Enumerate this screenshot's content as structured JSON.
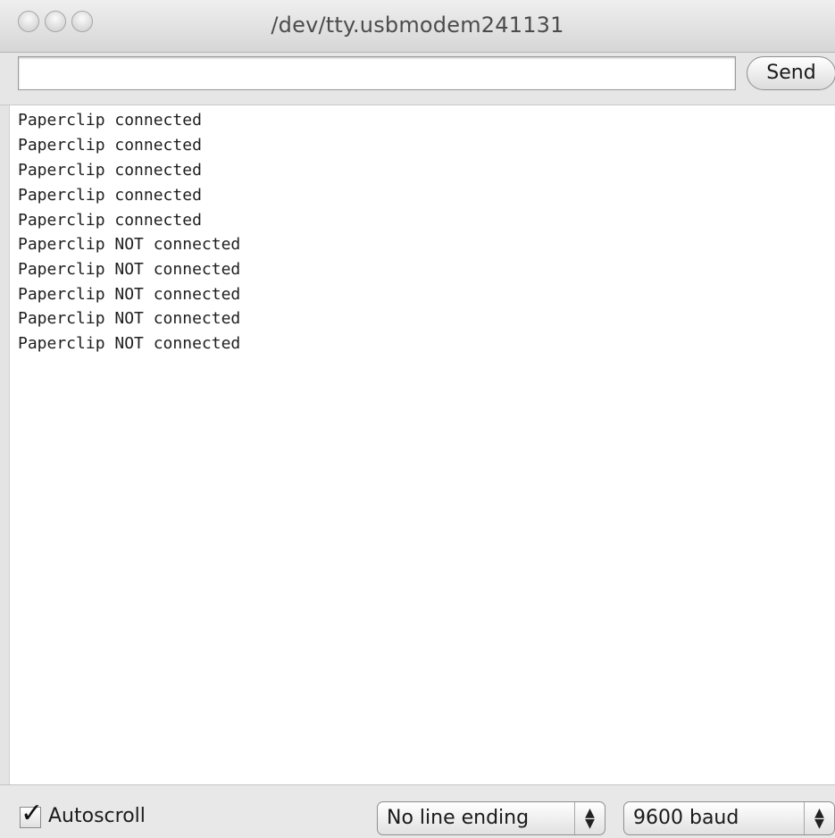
{
  "window": {
    "title": "/dev/tty.usbmodem241131"
  },
  "send_row": {
    "input_value": "",
    "button_label": "Send"
  },
  "output": {
    "lines": [
      "Paperclip connected",
      "Paperclip connected",
      "Paperclip connected",
      "Paperclip connected",
      "Paperclip connected",
      "Paperclip NOT connected",
      "Paperclip NOT connected",
      "Paperclip NOT connected",
      "Paperclip NOT connected",
      "Paperclip NOT connected"
    ]
  },
  "footer": {
    "autoscroll_label": "Autoscroll",
    "autoscroll_checked": true,
    "line_ending_selected": "No line ending",
    "baud_selected": "9600 baud"
  }
}
